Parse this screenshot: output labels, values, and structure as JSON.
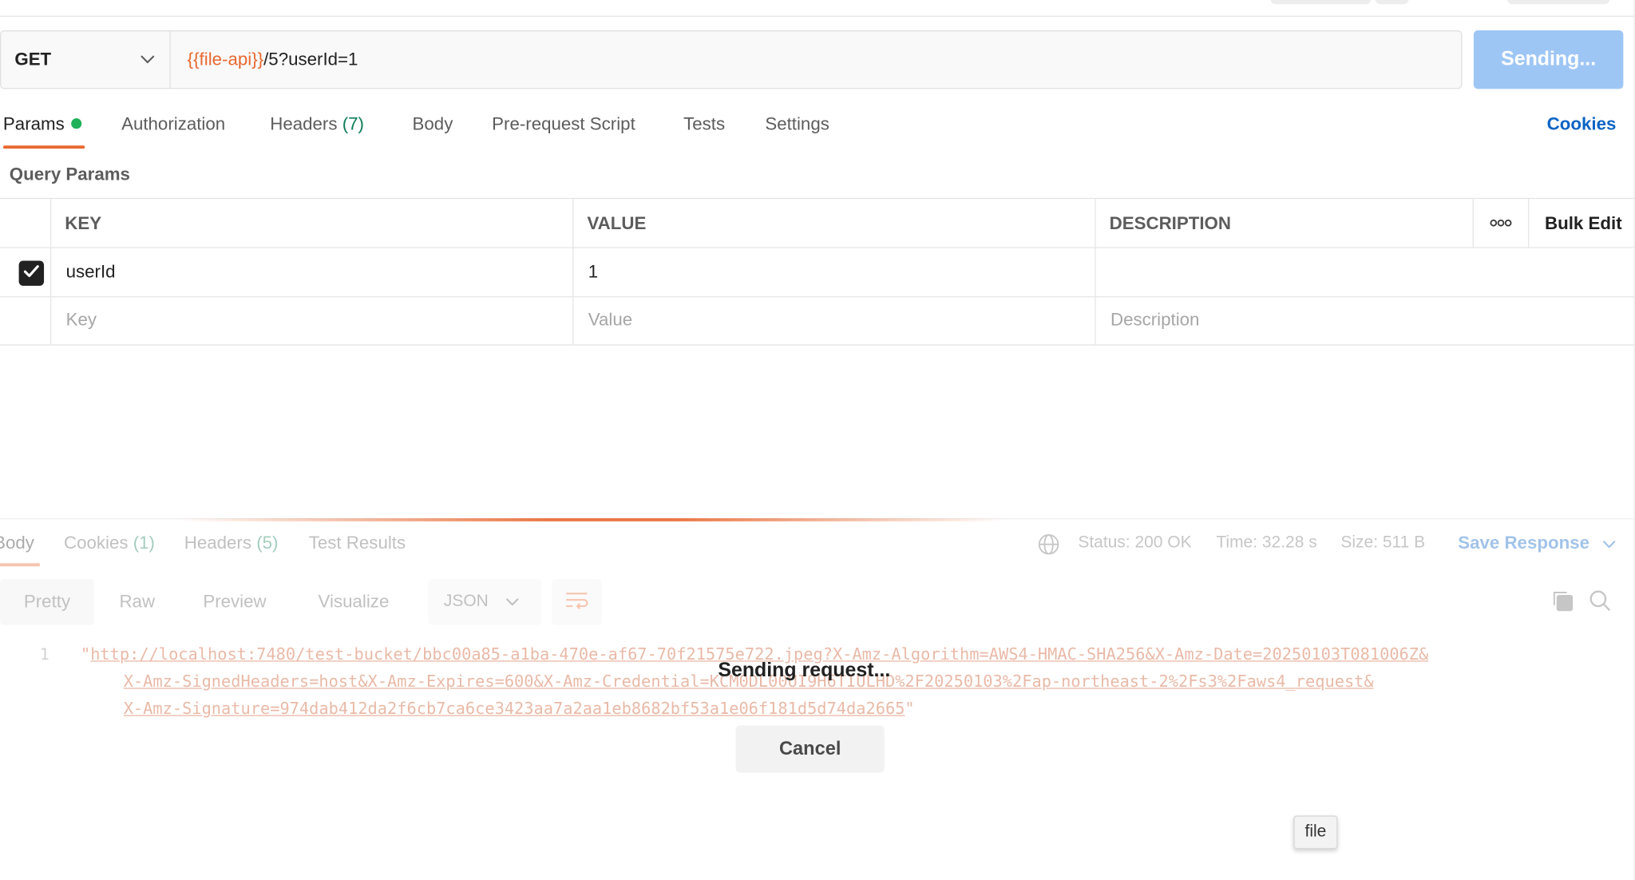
{
  "request": {
    "method": "GET",
    "url_variable": "{{file-api}}",
    "url_rest": "/5?userId=1",
    "send_label": "Sending..."
  },
  "request_tabs": {
    "params": "Params",
    "authorization": "Authorization",
    "headers": "Headers",
    "headers_count": "(7)",
    "body": "Body",
    "pre_request": "Pre-request Script",
    "tests": "Tests",
    "settings": "Settings",
    "cookies": "Cookies"
  },
  "query_params": {
    "title": "Query Params",
    "columns": {
      "key": "KEY",
      "value": "VALUE",
      "description": "DESCRIPTION",
      "bulk_edit": "Bulk Edit"
    },
    "rows": [
      {
        "checked": true,
        "key": "userId",
        "value": "1",
        "description": ""
      }
    ],
    "placeholders": {
      "key": "Key",
      "value": "Value",
      "description": "Description"
    }
  },
  "response": {
    "tabs": {
      "body": "Body",
      "cookies": "Cookies",
      "cookies_count": "(1)",
      "headers": "Headers",
      "headers_count": "(5)",
      "test_results": "Test Results"
    },
    "status": "Status: 200 OK",
    "time": "Time: 32.28 s",
    "size": "Size: 511 B",
    "save_response": "Save Response",
    "formats": {
      "pretty": "Pretty",
      "raw": "Raw",
      "preview": "Preview",
      "visualize": "Visualize"
    },
    "language": "JSON",
    "line_number": "1",
    "code_lines": [
      "http://localhost:7480/test-bucket/bbc00a85-a1ba-470e-af67-70f21575e722.jpeg?X-Amz-Algorithm=AWS4-HMAC-SHA256&X-Amz-Date=20250103T081006Z&",
      "X-Amz-SignedHeaders=host&X-Amz-Expires=600&X-Amz-Credential=KCM0DL00UI9H6TIULHD%2F20250103%2Fap-northeast-2%2Fs3%2Faws4_request&",
      "X-Amz-Signature=974dab412da2f6cb7ca6ce3423aa7a2aa1eb8682bf53a1e06f181d5d74da2665"
    ],
    "quote": "\""
  },
  "overlay": {
    "sending_text": "Sending request...",
    "cancel_label": "Cancel"
  },
  "tooltip": {
    "text": "file"
  },
  "colors": {
    "accent_orange": "#e8682f",
    "link_blue": "#0b63c5",
    "send_button": "#9ec6f5",
    "status_dot": "#20b15a",
    "count_green": "#0f7d55"
  },
  "icons": {
    "method_dropdown": "chevron-down-icon",
    "table_more": "more-horizontal-icon",
    "row_checkbox": "checkmark-icon",
    "network": "globe-icon",
    "save_dropdown": "chevron-down-icon",
    "wrap": "wrap-lines-icon",
    "copy": "copy-icon",
    "search": "search-icon"
  }
}
